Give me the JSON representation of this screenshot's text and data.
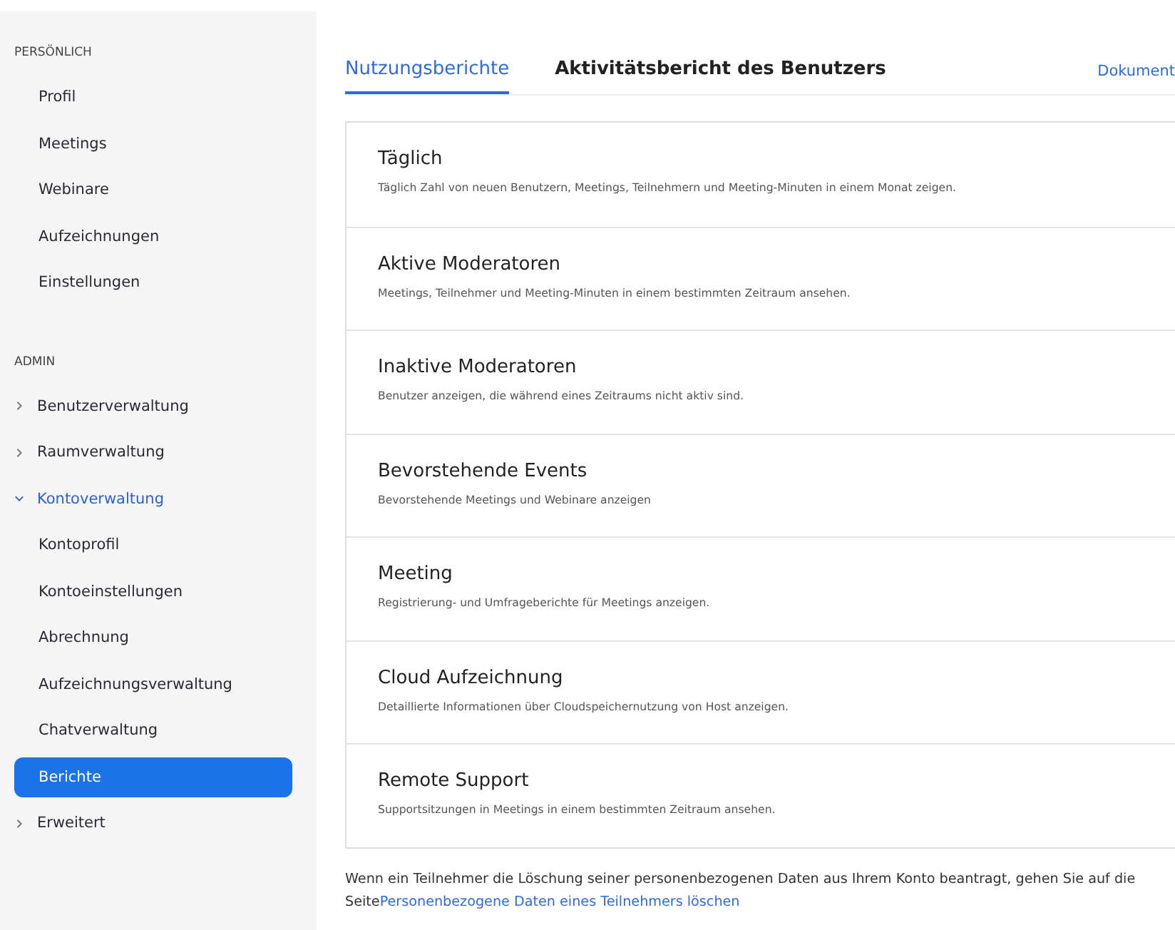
{
  "sidebar": {
    "sections": [
      {
        "title": "PERSÖNLICH",
        "items": [
          {
            "label": "Profil",
            "kind": "leaf",
            "selected": false
          },
          {
            "label": "Meetings",
            "kind": "leaf",
            "selected": false
          },
          {
            "label": "Webinare",
            "kind": "leaf",
            "selected": false
          },
          {
            "label": "Aufzeichnungen",
            "kind": "leaf",
            "selected": false
          },
          {
            "label": "Einstellungen",
            "kind": "leaf",
            "selected": false
          }
        ]
      },
      {
        "title": "ADMIN",
        "items": [
          {
            "label": "Benutzerverwaltung",
            "kind": "group",
            "expanded": false
          },
          {
            "label": "Raumverwaltung",
            "kind": "group",
            "expanded": false
          },
          {
            "label": "Kontoverwaltung",
            "kind": "group",
            "expanded": true,
            "children": [
              {
                "label": "Kontoprofil",
                "kind": "leaf",
                "selected": false
              },
              {
                "label": "Kontoeinstellungen",
                "kind": "leaf",
                "selected": false
              },
              {
                "label": "Abrechnung",
                "kind": "leaf",
                "selected": false
              },
              {
                "label": "Aufzeichnungsverwaltung",
                "kind": "leaf",
                "selected": false
              },
              {
                "label": "Chatverwaltung",
                "kind": "leaf",
                "selected": false
              },
              {
                "label": "Berichte",
                "kind": "leaf",
                "selected": true
              }
            ]
          },
          {
            "label": "Erweitert",
            "kind": "group",
            "expanded": false
          }
        ]
      }
    ]
  },
  "tabs": [
    {
      "label": "Nutzungsberichte",
      "selected": true
    },
    {
      "label": "Aktivitätsbericht des Benutzers",
      "selected": false
    }
  ],
  "doc_link": "Dokument",
  "reports": [
    {
      "title": "Täglich",
      "description": "Täglich Zahl von neuen Benutzern, Meetings, Teilnehmern und Meeting-Minuten in einem Monat zeigen."
    },
    {
      "title": "Aktive Moderatoren",
      "description": "Meetings, Teilnehmer und Meeting-Minuten in einem bestimmten Zeitraum ansehen."
    },
    {
      "title": "Inaktive Moderatoren",
      "description": "Benutzer anzeigen, die während eines Zeitraums nicht aktiv sind."
    },
    {
      "title": "Bevorstehende Events",
      "description": "Bevorstehende Meetings und Webinare anzeigen"
    },
    {
      "title": "Meeting",
      "description": "Registrierung- und Umfrageberichte für Meetings anzeigen."
    },
    {
      "title": "Cloud Aufzeichnung",
      "description": "Detaillierte Informationen über Cloudspeichernutzung von Host anzeigen."
    },
    {
      "title": "Remote Support",
      "description": "Supportsitzungen in Meetings in einem bestimmten Zeitraum ansehen."
    }
  ],
  "footer": {
    "text": "Wenn ein Teilnehmer die Löschung seiner personenbezogenen Daten aus Ihrem Konto beantragt, gehen Sie auf die Seite",
    "link": "Personenbezogene Daten eines Teilnehmers löschen"
  }
}
